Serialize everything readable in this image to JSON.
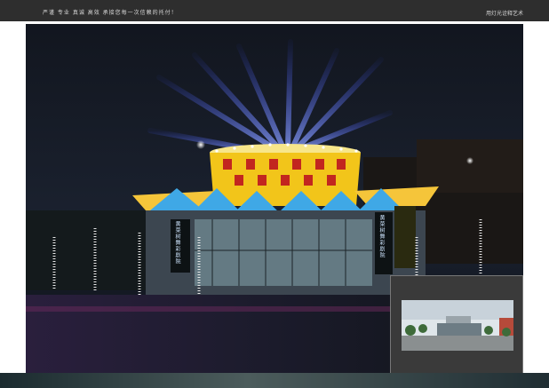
{
  "header": {
    "slogan": "严谨  专业  真诚  高效  承接您每一次信赖的托付！",
    "brand": "用灯光诠释艺术"
  },
  "photo": {
    "subject": "night facade lighting",
    "sign_left": "黄菜树舞彩剧院",
    "sign_right": "黄菜树舞彩剧院"
  },
  "inset": {
    "subject": "daytime view"
  },
  "colors": {
    "header_bg": "#2e2e2e",
    "sky": "#0b1018",
    "beam": "#5b7cff",
    "drum_yellow": "#f2c51a",
    "drum_red": "#c2261f",
    "facade_blue": "#3fa8e6"
  }
}
